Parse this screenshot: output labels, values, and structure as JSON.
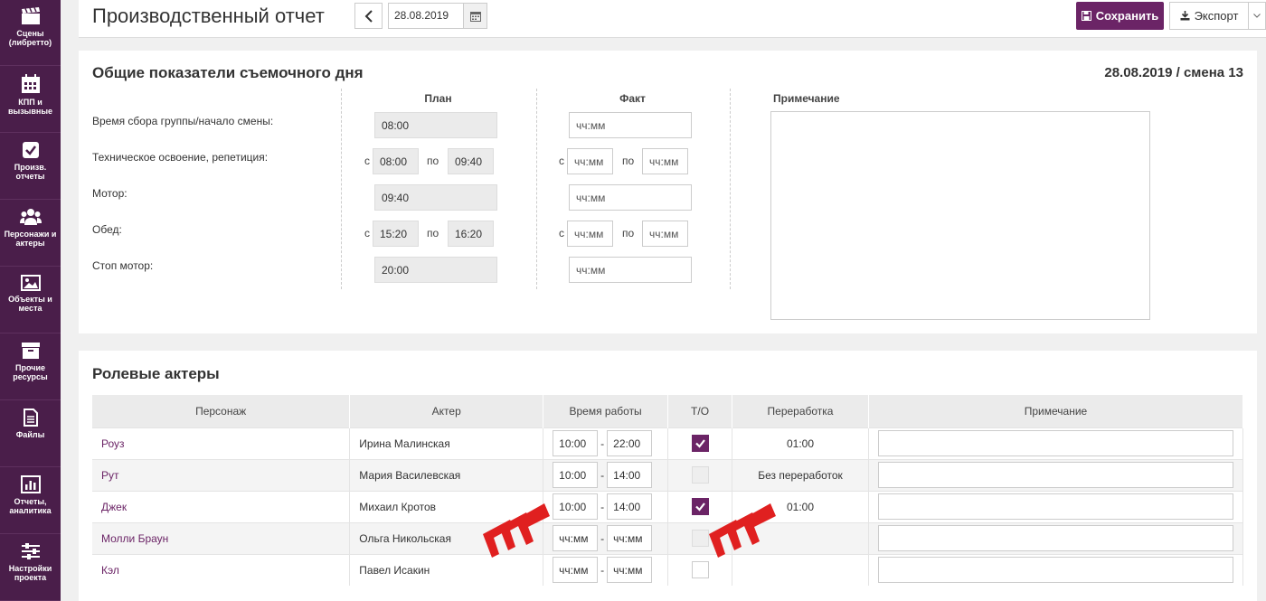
{
  "sidebar": {
    "items": [
      {
        "label": "Сцены\n(либретто)",
        "icon": "clapperboard-icon"
      },
      {
        "label": "КПП и\nвызывные",
        "icon": "calendar-icon"
      },
      {
        "label": "Произв.\nотчеты",
        "icon": "checkbox-icon"
      },
      {
        "label": "Персонажи и\nактеры",
        "icon": "users-icon"
      },
      {
        "label": "Объекты и\nместа",
        "icon": "image-icon"
      },
      {
        "label": "Прочие\nресурсы",
        "icon": "archive-icon"
      },
      {
        "label": "Файлы",
        "icon": "file-icon"
      },
      {
        "label": "Отчеты,\nаналитика",
        "icon": "bar-chart-icon"
      },
      {
        "label": "Настройки\nпроекта",
        "icon": "sliders-icon"
      }
    ]
  },
  "header": {
    "title": "Производственный отчет",
    "date": "28.08.2019",
    "save_label": "Сохранить",
    "export_label": "Экспорт"
  },
  "summary": {
    "title": "Общие показатели съемочного дня",
    "shift_info": "28.08.2019 / смена 13",
    "col_plan": "План",
    "col_fact": "Факт",
    "col_note": "Примечание",
    "from": "с",
    "to": "по",
    "rows": [
      {
        "label": "Время сбора группы/начало смены:",
        "plan": "08:00",
        "fact": "чч:мм"
      },
      {
        "label": "Техническое освоение, репетиция:",
        "plan_from": "08:00",
        "plan_to": "09:40",
        "fact_from": "чч:мм",
        "fact_to": "чч:мм"
      },
      {
        "label": "Мотор:",
        "plan": "09:40",
        "fact": "чч:мм"
      },
      {
        "label": "Обед:",
        "plan_from": "15:20",
        "plan_to": "16:20",
        "fact_from": "чч:мм",
        "fact_to": "чч:мм"
      },
      {
        "label": "Стоп мотор:",
        "plan": "20:00",
        "fact": "чч:мм"
      }
    ]
  },
  "actors": {
    "title": "Ролевые актеры",
    "columns": [
      "Персонаж",
      "Актер",
      "Время работы",
      "Т/О",
      "Переработка",
      "Примечание"
    ],
    "rows": [
      {
        "character": "Роуз",
        "actor": "Ирина Малинская",
        "from": "10:00",
        "to": "22:00",
        "to_checked": true,
        "overtime": "01:00",
        "overtime_color": "#e04040"
      },
      {
        "character": "Рут",
        "actor": "Мария Василевская",
        "from": "10:00",
        "to": "14:00",
        "to_checked": false,
        "overtime": "Без переработок",
        "overtime_color": "#2ea84a"
      },
      {
        "character": "Джек",
        "actor": "Михаил Кротов",
        "from": "10:00",
        "to": "14:00",
        "to_checked": true,
        "overtime": "01:00",
        "overtime_color": "#e04040"
      },
      {
        "character": "Молли Браун",
        "actor": "Ольга Никольская",
        "from": "чч:мм",
        "to": "чч:мм",
        "to_checked": false,
        "overtime": "",
        "overtime_color": ""
      },
      {
        "character": "Кэл",
        "actor": "Павел Исакин",
        "from": "чч:мм",
        "to": "чч:мм",
        "to_checked": false,
        "overtime": "",
        "overtime_color": ""
      }
    ],
    "dash": "-"
  },
  "colors": {
    "sidebar_bg": "#4a1e4a",
    "accent": "#6b2466",
    "overtime_red": "#e04040",
    "overtime_green": "#2ea84a",
    "annotation_arrow": "#e02020"
  }
}
